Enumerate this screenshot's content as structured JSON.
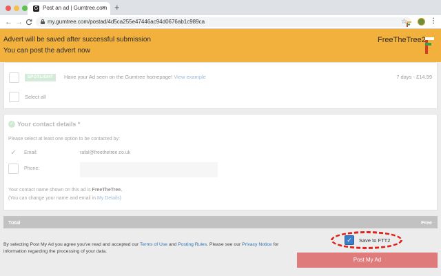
{
  "browser": {
    "tab_title": "Post an ad | Gumtree.com",
    "tab_favicon": "G",
    "new_tab": "+",
    "close_tab": "×",
    "url": "my.gumtree.com/postad/4d5ca255e47446ac94d0676ab1c989ca",
    "back": "←",
    "forward": "→",
    "reload": "C",
    "star": "☆",
    "menu": "⋮"
  },
  "banner": {
    "line1": "Advert will be saved after successful submission",
    "line2": "You can post the advert now",
    "brand": "FreeTheTree2",
    "color": "#f2b13c"
  },
  "spotlight": {
    "badge": "SPOTLIGHT",
    "text": "Have your Ad seen on the Gumtree homepage!",
    "link": "View example",
    "price": "7 days - £14.99",
    "select_all": "Select all"
  },
  "contact": {
    "check": "✓",
    "title": "Your contact details *",
    "hint": "Please select at least one option to be contacted by:",
    "email_check": "✓",
    "email_label": "Email:",
    "email_value": "rafal@freethetree.co.uk",
    "phone_label": "Phone:",
    "name_note_prefix": "Your contact name shown on this ad is ",
    "name_note_name": "FreeTheTree.",
    "name_note2_prefix": "(You can change your name and email in ",
    "name_note2_link": "My Details",
    "name_note2_suffix": ")"
  },
  "total": {
    "label": "Total",
    "value": "Free"
  },
  "terms": {
    "part1": "By selecting Post My Ad you agree you've read and accepted our ",
    "terms_link": "Terms of Use",
    "part2": " and ",
    "rules_link": "Posting Rules",
    "part3": ". Please see our ",
    "privacy_link": "Privacy Notice",
    "part4": " for information regarding the processing of your data."
  },
  "save": {
    "check": "✓",
    "label": "Save to FTT2",
    "checked": true,
    "highlight_color": "#e0221a"
  },
  "post_button": {
    "label": "Post My Ad",
    "color": "#e07b7b"
  }
}
